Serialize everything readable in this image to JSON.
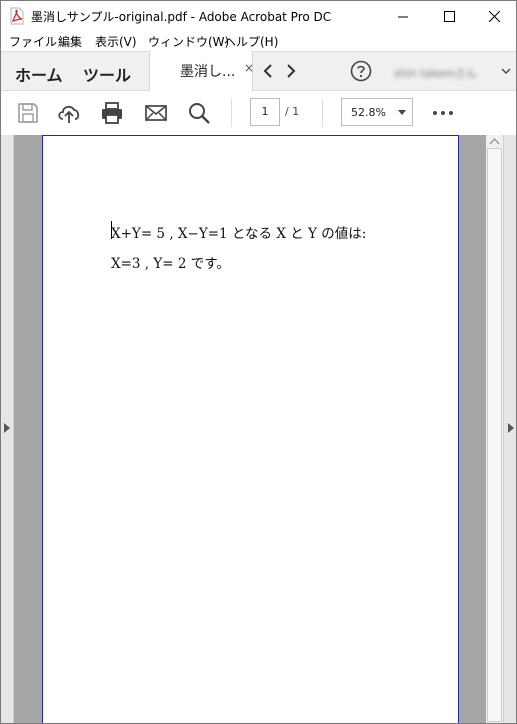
{
  "window": {
    "title": "墨消しサンプル-original.pdf - Adobe Acrobat Pro DC"
  },
  "menu": [
    "ファイル",
    "編集",
    "表示(V)",
    "ウィンドウ(W)",
    "ヘルプ(H)"
  ],
  "tabs": {
    "home": "ホーム",
    "tools": "ツール",
    "document": "墨消し...",
    "document_close": "×",
    "user": "shin takemさん"
  },
  "toolbar": {
    "page_current": "1",
    "page_total": "/ 1",
    "zoom": "52.8%"
  },
  "document": {
    "lines": [
      "X+Y= 5 , X−Y=1  となる X と Y の値は:",
      "X=3 , Y= 2 です。"
    ]
  },
  "colors": {
    "page_border": "#1e2aa8",
    "viewer_background": "#a6a6a6",
    "pdf_icon": "#d9241b"
  }
}
